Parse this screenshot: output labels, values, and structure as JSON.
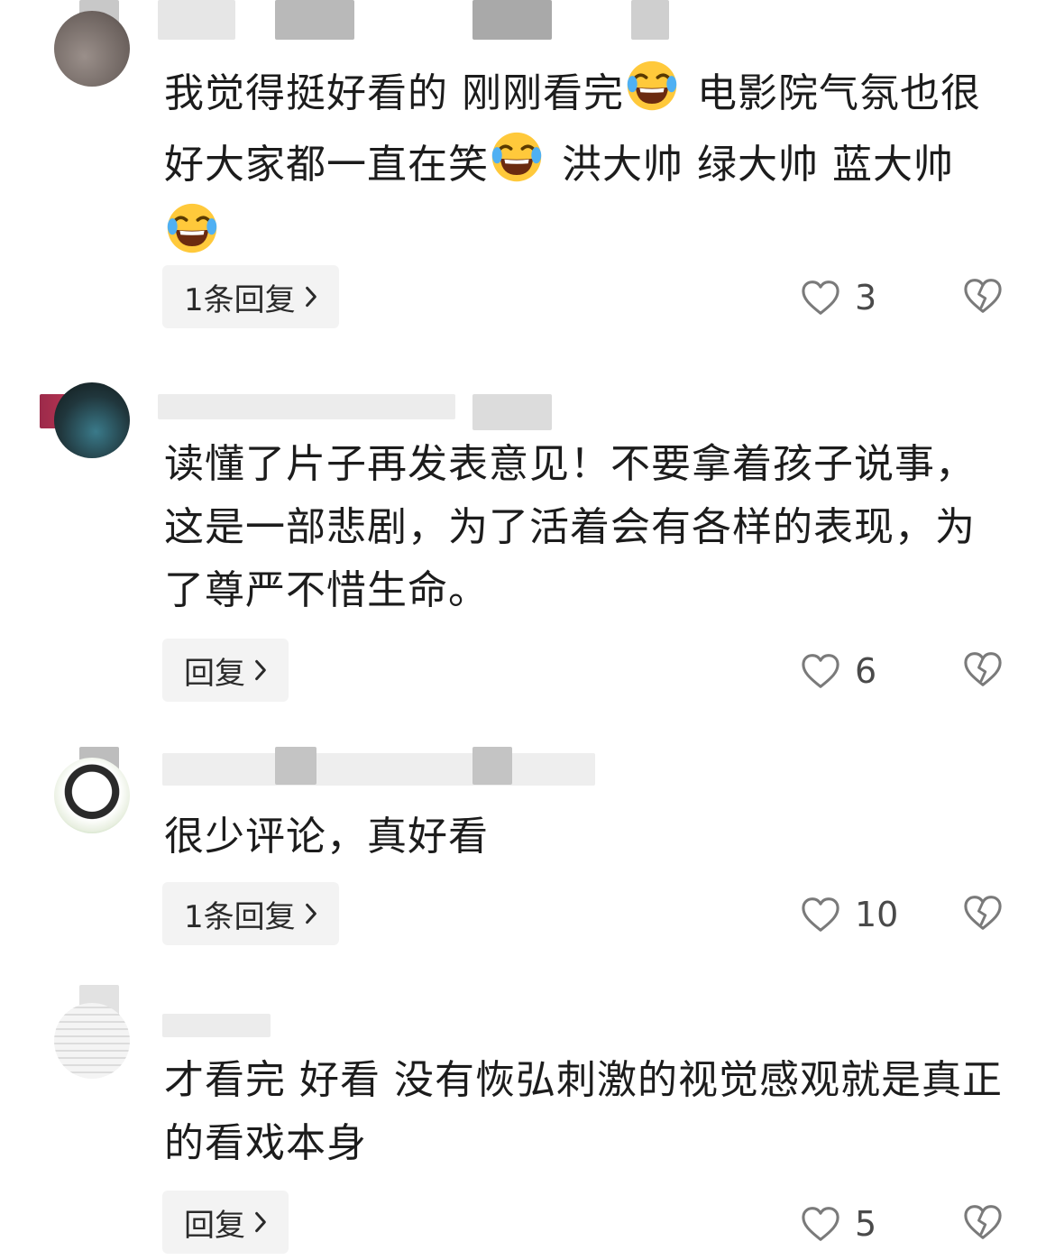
{
  "comments": [
    {
      "text_parts": [
        "我觉得挺好看的 刚刚看完",
        "emoji",
        " 电影院气氛也很好大家都一直在笑",
        "emoji",
        " 洪大帅 绿大帅 蓝大帅",
        "emoji"
      ],
      "reply_label": "1条回复",
      "likes": "3"
    },
    {
      "text": "读懂了片子再发表意见！不要拿着孩子说事，这是一部悲剧，为了活着会有各样的表现，为了尊严不惜生命。",
      "reply_label": "回复",
      "likes": "6"
    },
    {
      "text": "很少评论，真好看",
      "reply_label": "1条回复",
      "likes": "10"
    },
    {
      "text": "才看完 好看 没有恢弘刺激的视觉感观就是真正的看戏本身",
      "reply_label": "回复",
      "likes": "5"
    }
  ],
  "icons": {
    "emoji": "laughing-tears-emoji",
    "like": "heart-outline-icon",
    "dislike": "broken-heart-icon",
    "chevron": "chevron-right-icon"
  },
  "colors": {
    "text": "#1c1c1c",
    "button_bg": "#f3f3f3",
    "icon": "#7a7a7a"
  }
}
